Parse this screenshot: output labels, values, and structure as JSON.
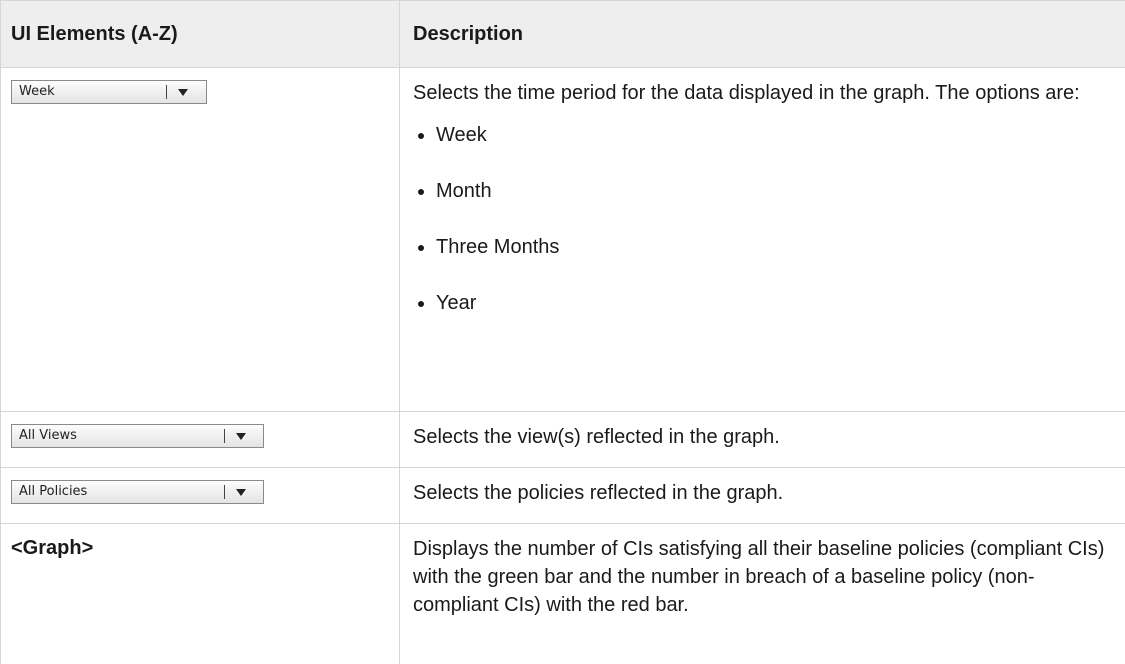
{
  "headers": {
    "col1": "UI Elements (A-Z)",
    "col2": "Description"
  },
  "rows": [
    {
      "element": {
        "type": "dropdown",
        "value": "Week"
      },
      "description": "Selects the time period for the data displayed in the graph. The options are:",
      "options": [
        "Week",
        "Month",
        "Three Months",
        "Year"
      ]
    },
    {
      "element": {
        "type": "dropdown",
        "value": "All Views"
      },
      "description": "Selects the view(s) reflected in the graph."
    },
    {
      "element": {
        "type": "dropdown",
        "value": "All Policies"
      },
      "description": "Selects the policies reflected in the graph."
    },
    {
      "element": {
        "type": "text",
        "value": "<Graph>"
      },
      "description": "Displays the number of CIs satisfying all their baseline policies (compliant CIs) with the green bar and the number in breach of a baseline policy (non-compliant CIs) with the red bar."
    }
  ]
}
